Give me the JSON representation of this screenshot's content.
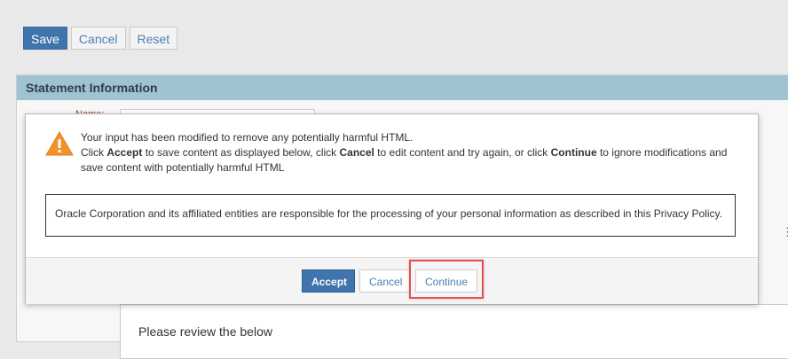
{
  "toolbar": {
    "save_label": "Save",
    "cancel_label": "Cancel",
    "reset_label": "Reset"
  },
  "section": {
    "title": "Statement Information",
    "name_label": "Name:"
  },
  "editor": {
    "preview_text": "Please review the below"
  },
  "modal": {
    "line1": "Your input has been modified to remove any potentially harmful HTML.",
    "line2_a": "Click ",
    "line2_accept": "Accept",
    "line2_b": " to save content as displayed below, click ",
    "line2_cancel": "Cancel",
    "line2_c": " to edit content and try again, or click ",
    "line2_continue": "Continue",
    "line2_d": " to ignore modifications and save content with potentially harmful HTML",
    "content": "Oracle Corporation and its affiliated entities are responsible for the processing of your personal information as described in this Privacy Policy.",
    "accept_label": "Accept",
    "cancel_label": "Cancel",
    "continue_label": "Continue"
  },
  "colors": {
    "primary": "#3f74ac",
    "header": "#9fc3d1",
    "warning": "#f0932b",
    "highlight": "#e0524f"
  }
}
